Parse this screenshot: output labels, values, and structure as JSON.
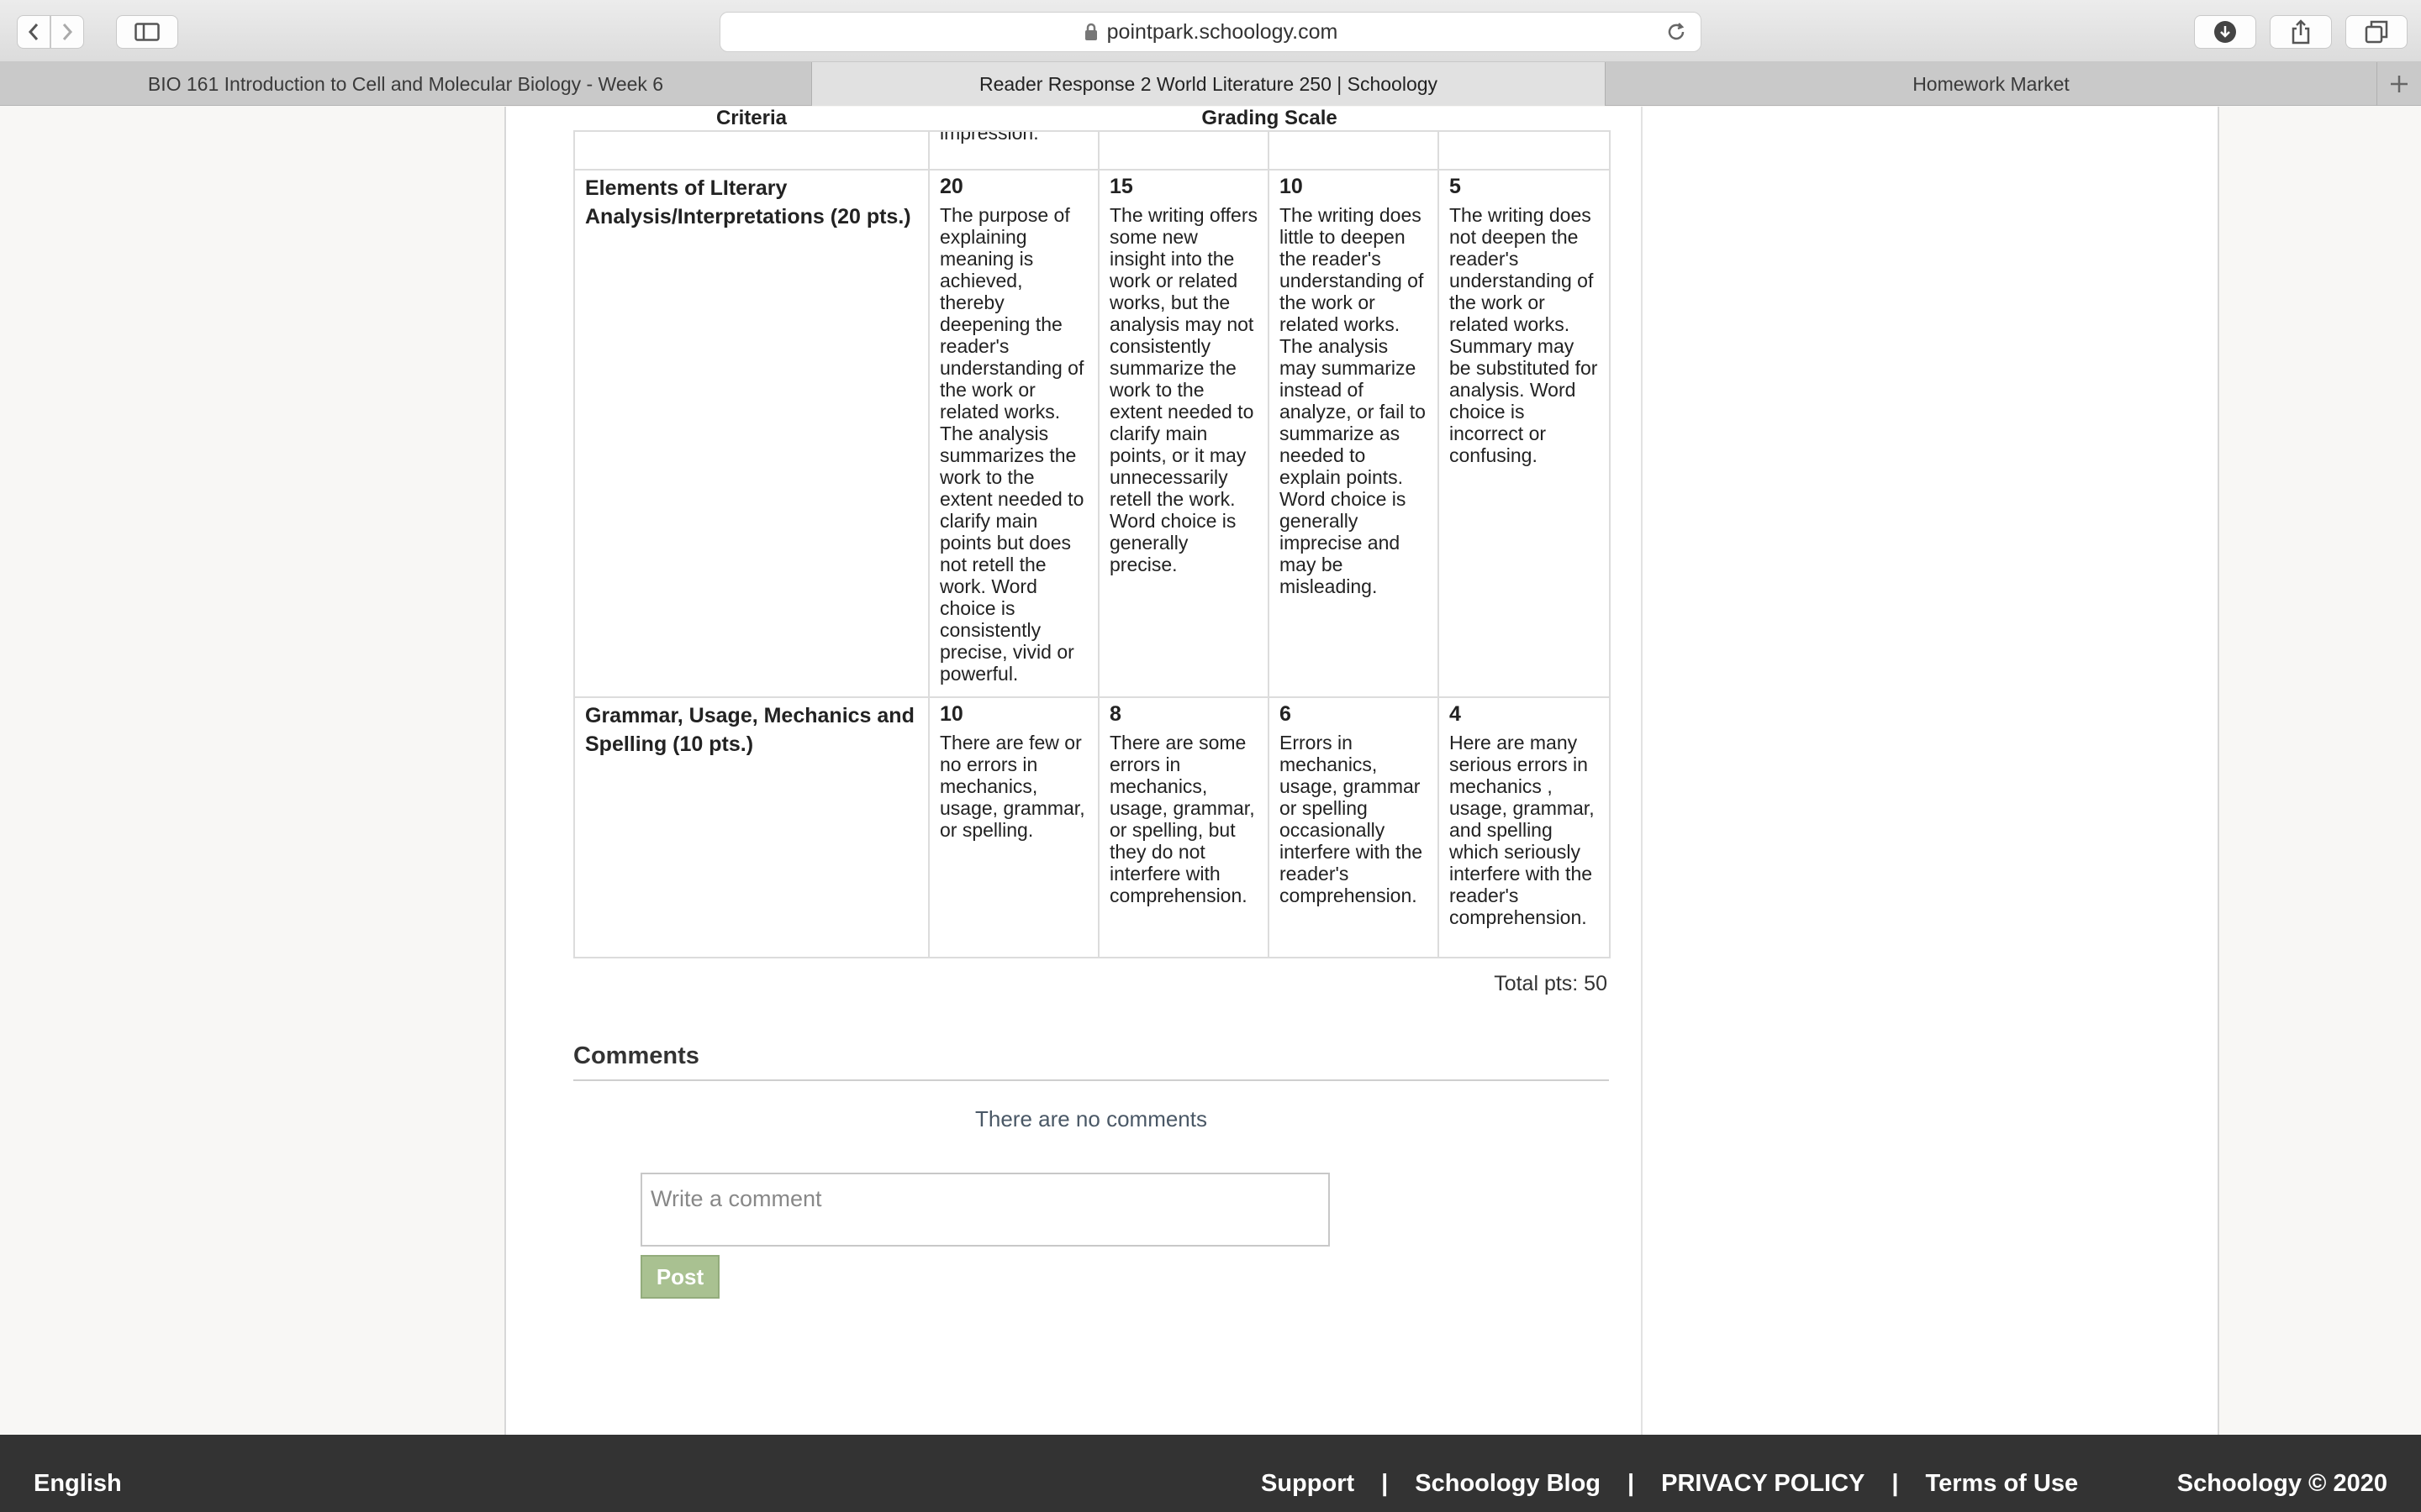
{
  "browser": {
    "url": "pointpark.schoology.com",
    "tabs": [
      {
        "label": "BIO 161 Introduction to Cell and Molecular Biology - Week 6"
      },
      {
        "label": "Reader Response 2 World Literature 250 | Schoology"
      },
      {
        "label": "Homework Market"
      }
    ]
  },
  "rubric": {
    "criteria_header": "Criteria",
    "scale_header": "Grading Scale",
    "cut_text": "impression.",
    "rows": [
      {
        "criterion": "Elements of LIterary Analysis/Interpretations (20 pts.)",
        "cells": [
          {
            "points": "20",
            "text": "The purpose of explaining meaning is achieved, thereby deepening the reader's understanding of the work or related works. The analysis summarizes the work to the extent needed to clarify main points but does not retell the work.  Word choice is consistently precise, vivid or powerful."
          },
          {
            "points": "15",
            "text": "The writing offers some new insight into the work or related works, but the analysis may not consistently summarize the work to the extent needed to clarify main points, or it may unnecessarily retell the work. Word choice is generally precise."
          },
          {
            "points": "10",
            "text": "The writing does little to deepen the reader's understanding of the work or related works. The analysis may summarize instead of analyze, or fail to summarize as needed to explain points. Word choice is generally imprecise and may be misleading."
          },
          {
            "points": "5",
            "text": "The writing does not deepen the reader's understanding of the work or related works. Summary may be substituted for analysis. Word choice is incorrect or confusing."
          }
        ]
      },
      {
        "criterion": "Grammar, Usage, Mechanics and Spelling (10 pts.)",
        "cells": [
          {
            "points": "10",
            "text": "There are few or no errors in mechanics, usage, grammar, or spelling."
          },
          {
            "points": "8",
            "text": "There are some errors in mechanics, usage, grammar, or spelling, but they do not interfere with comprehension."
          },
          {
            "points": "6",
            "text": "Errors in mechanics, usage, grammar or spelling occasionally interfere with the reader's comprehension."
          },
          {
            "points": "4",
            "text": "Here are many serious errors in mechanics , usage, grammar, and spelling which seriously interfere with the reader's comprehension."
          }
        ]
      }
    ],
    "total": "Total pts: 50"
  },
  "comments": {
    "title": "Comments",
    "empty_text": "There are no comments",
    "placeholder": "Write a comment",
    "post_label": "Post"
  },
  "footer": {
    "language": "English",
    "links": [
      "Support",
      "Schoology Blog",
      "PRIVACY POLICY",
      "Terms of Use"
    ],
    "separator": "|",
    "copyright": "Schoology © 2020"
  }
}
